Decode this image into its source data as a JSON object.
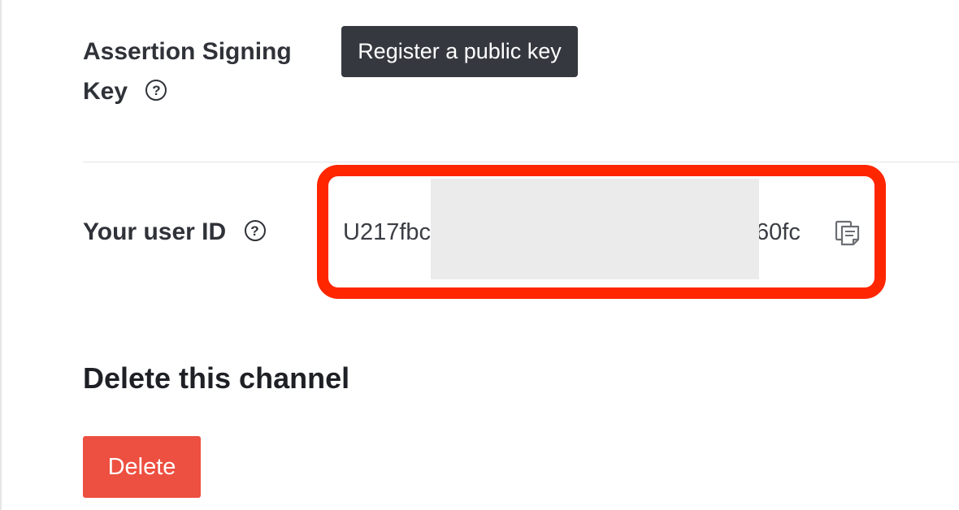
{
  "assertion_key": {
    "label_line1": "Assertion Signing",
    "label_line2": "Key",
    "help_glyph": "?",
    "register_button_label": "Register a public key"
  },
  "user_id": {
    "label": "Your user ID",
    "help_glyph": "?",
    "value_visible_start": "U217fbc",
    "value_visible_end": "60fc",
    "copy_icon": "copy-icon"
  },
  "delete_section": {
    "title": "Delete this channel",
    "delete_button_label": "Delete"
  },
  "colors": {
    "highlight_border": "#ff2600",
    "dark_button": "#35393f",
    "delete_button": "#ed4f40",
    "redaction": "#ebebeb"
  }
}
